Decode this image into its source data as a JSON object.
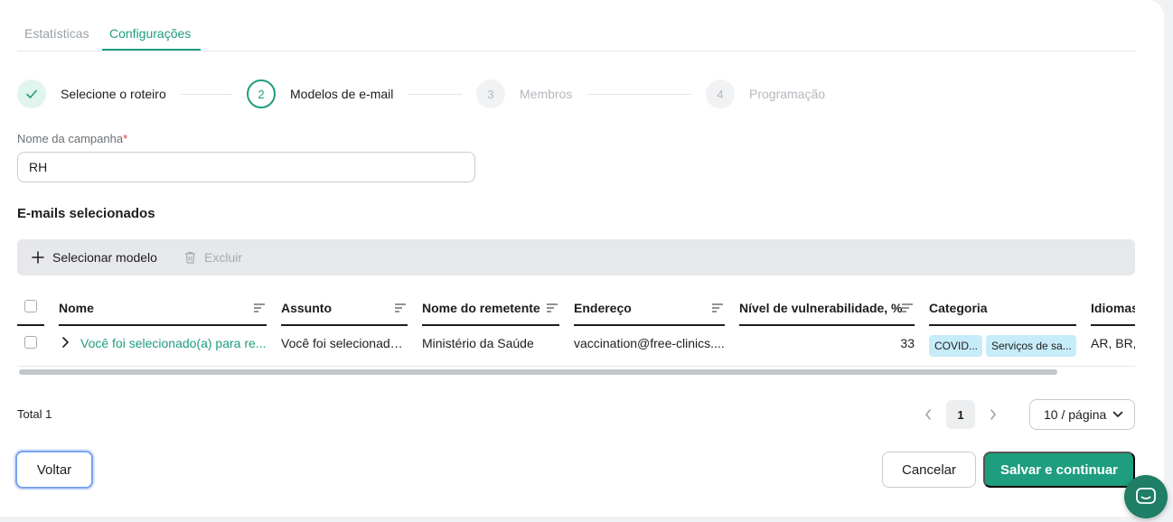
{
  "tabs": [
    {
      "label": "Estatísticas"
    },
    {
      "label": "Configurações",
      "active": true
    }
  ],
  "stepper": [
    {
      "number": "",
      "label": "Selecione o roteiro",
      "state": "done"
    },
    {
      "number": "2",
      "label": "Modelos de e-mail",
      "state": "active"
    },
    {
      "number": "3",
      "label": "Membros",
      "state": "pending"
    },
    {
      "number": "4",
      "label": "Programação",
      "state": "pending"
    }
  ],
  "campaign": {
    "label": "Nome da campanha",
    "required_mark": "*",
    "value": "RH"
  },
  "section_title": "E-mails selecionados",
  "toolbar": {
    "add_label": "Selecionar modelo",
    "delete_label": "Excluir"
  },
  "table": {
    "columns": [
      "Nome",
      "Assunto",
      "Nome do remetente",
      "Endereço",
      "Nível de vulnerabilidade, %",
      "Categoria",
      "Idiomas"
    ],
    "rows": [
      {
        "nome": "Você foi selecionado(a) para re...",
        "assunto": "Você foi selecionado(...",
        "remetente": "Ministério da Saúde",
        "endereco": "vaccination@free-clinics....",
        "vulnerabilidade": "33",
        "categorias": [
          "COVID...",
          "Serviços de sa..."
        ],
        "idiomas": "AR, BR, E"
      }
    ]
  },
  "pagination": {
    "total": "Total 1",
    "current_page": "1",
    "per_page": "10 / página"
  },
  "buttons": {
    "back": "Voltar",
    "cancel": "Cancelar",
    "save": "Salvar e continuar"
  },
  "colors": {
    "accent": "#1e9d7f",
    "tag_bg": "#c7ecf9"
  }
}
